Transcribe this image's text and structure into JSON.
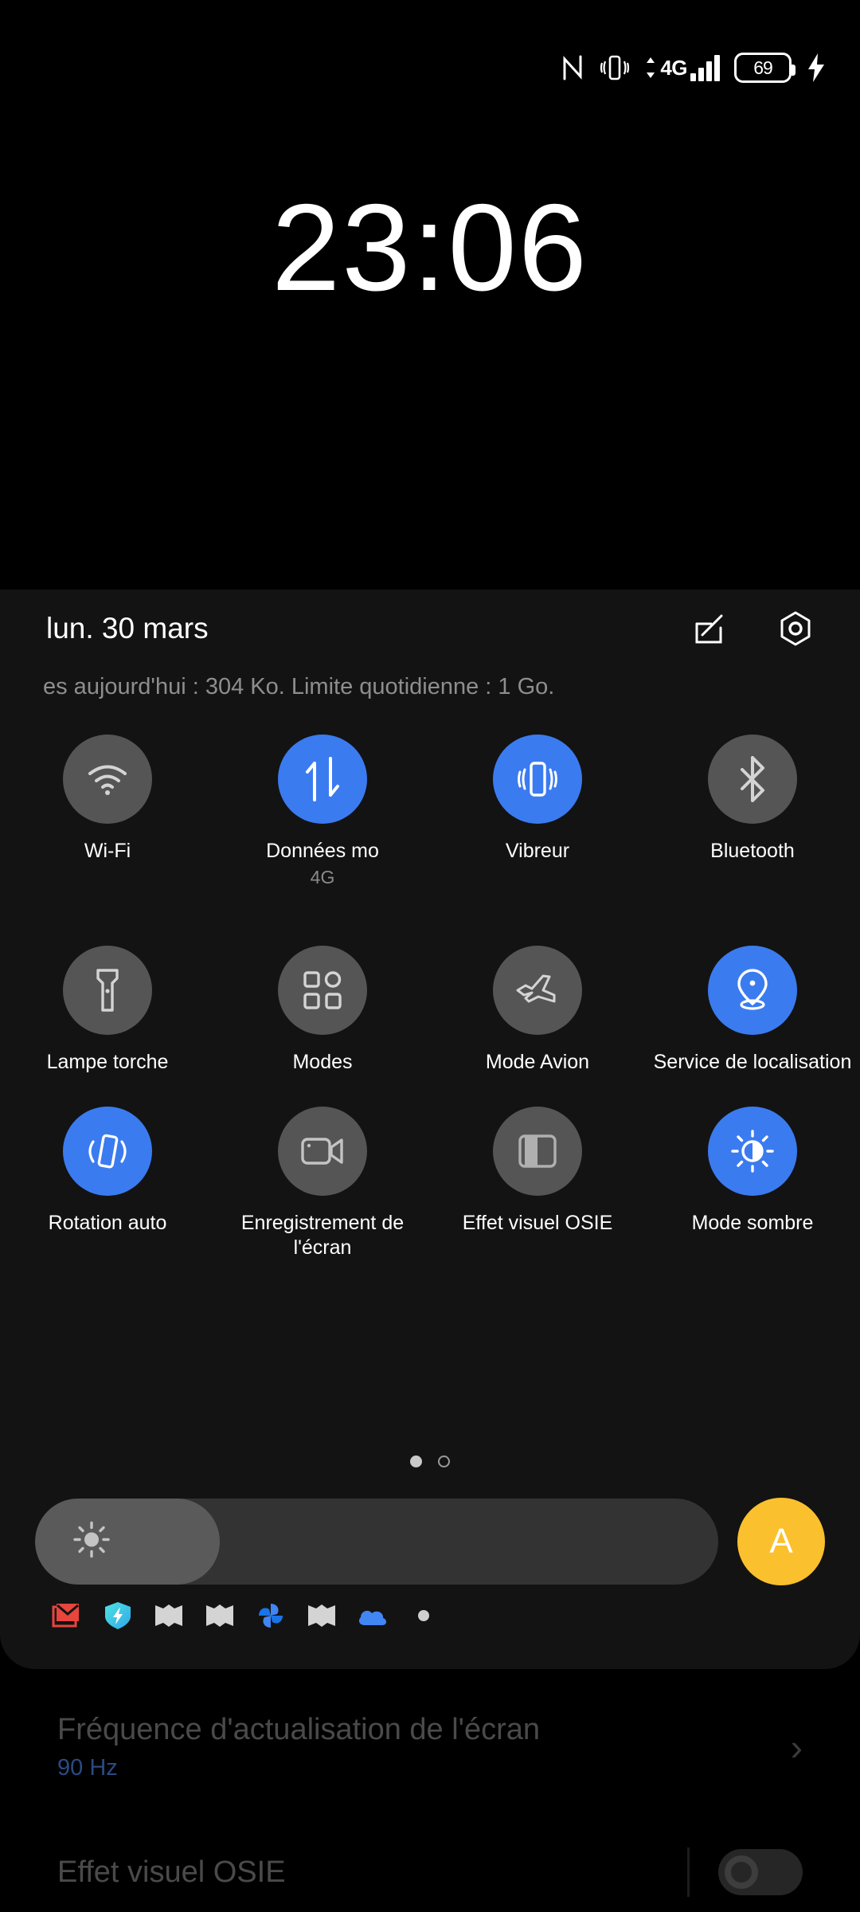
{
  "statusbar": {
    "icons": [
      "nfc-icon",
      "vibrate-icon",
      "data-updown-icon",
      "signal-bars-icon",
      "battery-icon",
      "charging-bolt-icon"
    ],
    "network_type": "4G",
    "battery_level": "69"
  },
  "clock": {
    "time": "23:06"
  },
  "panel": {
    "date": "lun. 30 mars",
    "data_usage": "es aujourd'hui : 304 Ko. Limite quotidienne : 1 Go.",
    "edit_icon": "edit-icon",
    "settings_icon": "settings-icon"
  },
  "tiles": [
    {
      "label": "Wi-Fi",
      "icon": "wifi-icon",
      "state": "off",
      "sub": ""
    },
    {
      "label": "Données mo",
      "icon": "mobile-data-icon",
      "state": "on",
      "sub": "4G"
    },
    {
      "label": "Vibreur",
      "icon": "vibrate-icon",
      "state": "on",
      "sub": ""
    },
    {
      "label": "Bluetooth",
      "icon": "bluetooth-icon",
      "state": "off",
      "sub": ""
    },
    {
      "label": "Lampe torche",
      "icon": "flashlight-icon",
      "state": "off",
      "sub": ""
    },
    {
      "label": "Modes",
      "icon": "modes-icon",
      "state": "off",
      "sub": ""
    },
    {
      "label": "Mode Avion",
      "icon": "airplane-icon",
      "state": "off",
      "sub": ""
    },
    {
      "label": "Service de localisation",
      "icon": "location-icon",
      "state": "on",
      "sub": ""
    },
    {
      "label": "Rotation auto",
      "icon": "auto-rotate-icon",
      "state": "on",
      "sub": ""
    },
    {
      "label": "Enregistrement de l'écran",
      "icon": "screen-record-icon",
      "state": "off",
      "sub": ""
    },
    {
      "label": "Effet visuel OSIE",
      "icon": "osie-icon",
      "state": "off",
      "sub": ""
    },
    {
      "label": "Mode sombre",
      "icon": "dark-mode-icon",
      "state": "on",
      "sub": ""
    }
  ],
  "pager": {
    "pages": 2,
    "active": 1
  },
  "brightness": {
    "value_percent": 27,
    "auto_label": "A",
    "icon": "brightness-icon"
  },
  "notifications": {
    "icons": [
      "gmail-icon",
      "security-shield-icon",
      "maps-icon",
      "maps-icon",
      "photos-icon",
      "maps-icon",
      "cloud-icon",
      "more-dot-icon"
    ]
  },
  "settings_rows": [
    {
      "title": "Fréquence d'actualisation de l'écran",
      "subtitle": "90 Hz",
      "control": "chevron-right-icon",
      "chevron": "›"
    },
    {
      "title": "Effet visuel OSIE",
      "subtitle": "",
      "control": "toggle-switch",
      "state": "off"
    }
  ],
  "colors": {
    "accent_blue": "#3b7bf0",
    "tile_off": "#555555",
    "panel_bg": "#131313",
    "auto_yellow": "#fbc02d",
    "subtitle_blue": "#2b4a84"
  }
}
